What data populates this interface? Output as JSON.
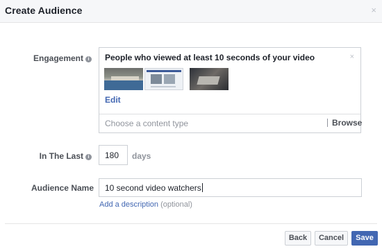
{
  "dialog": {
    "title": "Create Audience",
    "close_glyph": "×"
  },
  "engagement": {
    "label": "Engagement",
    "info_icon": "info-icon",
    "selected_title": "People who viewed at least 10 seconds of your video",
    "remove_glyph": "×",
    "edit_label": "Edit",
    "content_type_placeholder": "Choose a content type",
    "browse_label": "Browse"
  },
  "in_the_last": {
    "label": "In The Last",
    "value": "180",
    "unit": "days"
  },
  "audience_name": {
    "label": "Audience Name",
    "value": "10 second video watchers",
    "description_link": "Add a description",
    "optional": "(optional)"
  },
  "buttons": {
    "back": "Back",
    "cancel": "Cancel",
    "save": "Save"
  },
  "colors": {
    "accent": "#4267b2",
    "header_bg": "#f6f7f9",
    "label": "#4b4f56",
    "muted": "#90949c"
  }
}
